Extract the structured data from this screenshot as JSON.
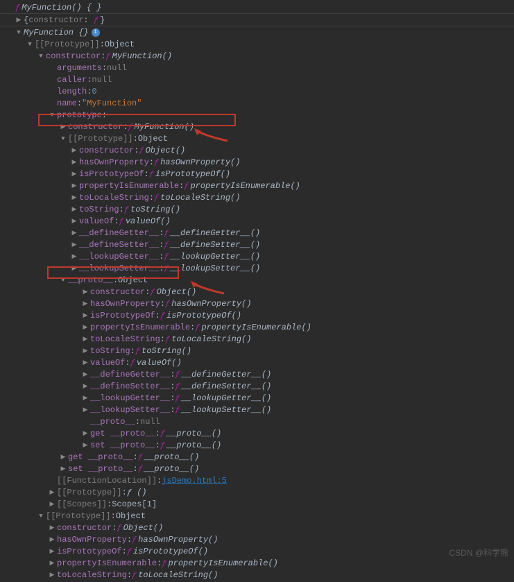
{
  "header": {
    "fn_symbol": "ƒ",
    "sig": "MyFunction() { }"
  },
  "r1": {
    "brace_open": "{",
    "key": "constructor",
    "colon": ": ",
    "val": "ƒ",
    "brace_close": "}"
  },
  "r2": {
    "label": "MyFunction",
    "braces": " {}"
  },
  "r3": {
    "key": "[[Prototype]]",
    "val": "Object"
  },
  "r4": {
    "key": "constructor",
    "fn": "ƒ",
    "val": "MyFunction()"
  },
  "r5": {
    "key": "arguments",
    "val": "null"
  },
  "r6": {
    "key": "caller",
    "val": "null"
  },
  "r7": {
    "key": "length",
    "val": "0"
  },
  "r8": {
    "key": "name",
    "val": "\"MyFunction\""
  },
  "r9": {
    "key": "prototype",
    "colon": ":"
  },
  "r10": {
    "key": "constructor",
    "fn": "ƒ",
    "val": "MyFunction()"
  },
  "r11": {
    "key": "[[Prototype]]",
    "val": "Object"
  },
  "obj_proto": [
    {
      "key": "constructor",
      "val": "Object()"
    },
    {
      "key": "hasOwnProperty",
      "val": "hasOwnProperty()"
    },
    {
      "key": "isPrototypeOf",
      "val": "isPrototypeOf()"
    },
    {
      "key": "propertyIsEnumerable",
      "val": "propertyIsEnumerable()"
    },
    {
      "key": "toLocaleString",
      "val": "toLocaleString()"
    },
    {
      "key": "toString",
      "val": "toString()"
    },
    {
      "key": "valueOf",
      "val": "valueOf()"
    },
    {
      "key": "__defineGetter__",
      "val": "__defineGetter__()"
    },
    {
      "key": "__defineSetter__",
      "val": "__defineSetter__()"
    },
    {
      "key": "__lookupGetter__",
      "val": "__lookupGetter__()"
    },
    {
      "key": "__lookupSetter__",
      "val": "__lookupSetter__()"
    }
  ],
  "r_dunder": {
    "key": "__proto__",
    "val": "Object"
  },
  "r_dunder_null": {
    "key": "__proto__",
    "val": "null"
  },
  "getset": [
    {
      "key": "get __proto__",
      "val": "__proto__()"
    },
    {
      "key": "set __proto__",
      "val": "__proto__()"
    }
  ],
  "r_funcloc": {
    "key": "[[FunctionLocation]]",
    "val": "jsDemo.html:5"
  },
  "r_proto2": {
    "key": "[[Prototype]]",
    "val": "ƒ ()"
  },
  "r_scopes": {
    "key": "[[Scopes]]",
    "val": "Scopes[1]"
  },
  "r_outer_proto": {
    "key": "[[Prototype]]",
    "val": "Object"
  },
  "watermark": "CSDN @科学熊"
}
